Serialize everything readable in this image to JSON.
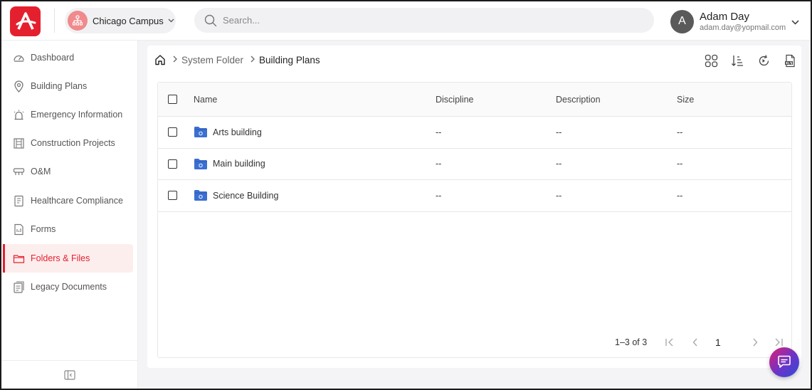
{
  "header": {
    "campus": {
      "name": "Chicago Campus",
      "icon": "campus-network-icon"
    },
    "search": {
      "placeholder": "Search..."
    },
    "user": {
      "initial": "A",
      "name": "Adam Day",
      "email": "adam.day@yopmail.com"
    }
  },
  "sidebar": {
    "items": [
      {
        "label": "Dashboard",
        "icon": "speedometer-icon",
        "active": false
      },
      {
        "label": "Building Plans",
        "icon": "map-pin-icon",
        "active": false
      },
      {
        "label": "Emergency Information",
        "icon": "alarm-light-icon",
        "active": false
      },
      {
        "label": "Construction Projects",
        "icon": "construction-icon",
        "active": false
      },
      {
        "label": "O&M",
        "icon": "maintenance-icon",
        "active": false
      },
      {
        "label": "Healthcare Compliance",
        "icon": "notebook-icon",
        "active": false
      },
      {
        "label": "Forms",
        "icon": "form-document-icon",
        "active": false
      },
      {
        "label": "Folders & Files",
        "icon": "folder-icon",
        "active": true
      },
      {
        "label": "Legacy Documents",
        "icon": "documents-icon",
        "active": false
      }
    ]
  },
  "breadcrumb": {
    "items": [
      "System Folder",
      "Building Plans"
    ]
  },
  "table": {
    "columns": [
      "Name",
      "Discipline",
      "Description",
      "Size"
    ],
    "rows": [
      {
        "name": "Arts building",
        "discipline": "--",
        "description": "--",
        "size": "--"
      },
      {
        "name": "Main building",
        "discipline": "--",
        "description": "--",
        "size": "--"
      },
      {
        "name": "Science Building",
        "discipline": "--",
        "description": "--",
        "size": "--"
      }
    ]
  },
  "pagination": {
    "range": "1–3 of 3",
    "page": "1"
  },
  "colors": {
    "accent": "#e5202e",
    "folder": "#3b6fd1",
    "active_bg": "#fdeeee"
  }
}
